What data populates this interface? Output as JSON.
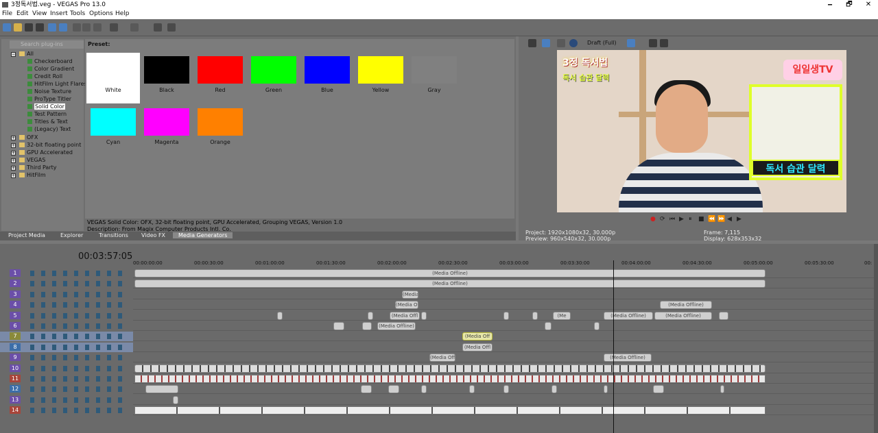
{
  "window": {
    "title": "3정독서법.veg - VEGAS Pro 13.0",
    "min": "🗕",
    "max": "🗗",
    "close": "✕"
  },
  "menu": [
    "File",
    "Edit",
    "View",
    "Insert",
    "Tools",
    "Options",
    "Help"
  ],
  "search": {
    "placeholder": "Search plug-ins"
  },
  "tree": {
    "all": "All",
    "children": [
      "Checkerboard",
      "Color Gradient",
      "Credit Roll",
      "HitFilm Light Flares",
      "Noise Texture",
      "ProType Titler",
      "Solid Color",
      "Test Pattern",
      "Titles & Text",
      "(Legacy) Text"
    ],
    "selected": "Solid Color",
    "folders": [
      "OFX",
      "32-bit floating point",
      "GPU Accelerated",
      "VEGAS",
      "Third Party",
      "HitFilm"
    ]
  },
  "preset": {
    "label": "Preset:"
  },
  "presets": [
    {
      "name": "White",
      "color": "#ffffff"
    },
    {
      "name": "Black",
      "color": "#000000"
    },
    {
      "name": "Red",
      "color": "#ff0000"
    },
    {
      "name": "Green",
      "color": "#00ff00"
    },
    {
      "name": "Blue",
      "color": "#0000ff"
    },
    {
      "name": "Yellow",
      "color": "#ffff00"
    },
    {
      "name": "Gray",
      "color": "#808080"
    },
    {
      "name": "Cyan",
      "color": "#00ffff"
    },
    {
      "name": "Magenta",
      "color": "#ff00ff"
    },
    {
      "name": "Orange",
      "color": "#ff8000"
    }
  ],
  "description": {
    "line1": "VEGAS Solid Color: OFX, 32-bit floating point, GPU Accelerated, Grouping VEGAS, Version 1.0",
    "line2": "Description: From Magix Computer Products Intl. Co."
  },
  "tabs": [
    "Project Media",
    "Explorer",
    "Transitions",
    "Video FX",
    "Media Generators"
  ],
  "activeTab": "Media Generators",
  "previewToolbar": {
    "quality": "Draft (Full)"
  },
  "preview": {
    "caption1": "3정 독서법",
    "caption2": "독서 습관 달력",
    "brand": "일일생TV",
    "caption3": "독서 습관 달력"
  },
  "info": {
    "project_label": "Project:",
    "project": "1920x1080x32, 30.000p",
    "preview_label": "Preview:",
    "preview": "960x540x32, 30.000p",
    "frame_label": "Frame:",
    "frame": "7,115",
    "display_label": "Display:",
    "display": "628x353x32"
  },
  "timeline": {
    "timecode": "00:03:57:05",
    "ruler": [
      "00:00:00:00",
      "00:00:30:00",
      "00:01:00:00",
      "00:01:30:00",
      "00:02:00:00",
      "00:02:30:00",
      "00:03:00:00",
      "00:03:30:00",
      "00:04:00:00",
      "00:04:30:00",
      "00:05:00:00",
      "00:05:30:00",
      "00:"
    ],
    "offline": "(Media Offline)",
    "short": [
      "(Media",
      "(Media Off",
      "(Media Offl",
      "(Media Offline)",
      "(Me"
    ]
  },
  "tracks": [
    {
      "n": "1",
      "type": "video",
      "color": "#6b4fa8"
    },
    {
      "n": "2",
      "type": "video",
      "color": "#6b4fa8"
    },
    {
      "n": "3",
      "type": "video",
      "color": "#6b4fa8"
    },
    {
      "n": "4",
      "type": "video",
      "color": "#6b4fa8"
    },
    {
      "n": "5",
      "type": "video",
      "color": "#6b4fa8"
    },
    {
      "n": "6",
      "type": "video",
      "color": "#6b4fa8"
    },
    {
      "n": "7",
      "type": "video",
      "color": "#8a8a3a"
    },
    {
      "n": "8",
      "type": "video",
      "color": "#3c6ea8"
    },
    {
      "n": "9",
      "type": "video",
      "color": "#6b4fa8"
    },
    {
      "n": "10",
      "type": "video",
      "color": "#6b4fa8"
    },
    {
      "n": "11",
      "type": "audio",
      "color": "#a8453a"
    },
    {
      "n": "12",
      "type": "audio",
      "color": "#3c6ea8"
    },
    {
      "n": "13",
      "type": "audio",
      "color": "#6b4fa8"
    },
    {
      "n": "14",
      "type": "audio",
      "color": "#a8453a"
    }
  ]
}
